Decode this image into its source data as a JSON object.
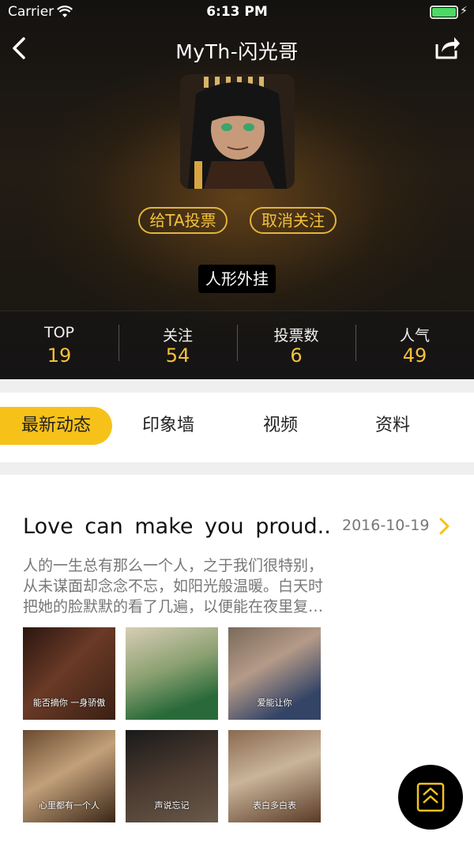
{
  "status_bar": {
    "carrier": "Carrier",
    "time": "6:13 PM"
  },
  "header": {
    "title": "MyTh-闪光哥",
    "vote_label": "给TA投票",
    "unfollow_label": "取消关注",
    "tag": "人形外挂"
  },
  "stats": [
    {
      "label": "TOP",
      "value": "19"
    },
    {
      "label": "关注",
      "value": "54"
    },
    {
      "label": "投票数",
      "value": "6"
    },
    {
      "label": "人气",
      "value": "49"
    }
  ],
  "tabs": [
    {
      "label": "最新动态",
      "active": true
    },
    {
      "label": "印象墙",
      "active": false
    },
    {
      "label": "视频",
      "active": false
    },
    {
      "label": "资料",
      "active": false
    }
  ],
  "post": {
    "title": "Love can make you proud...",
    "date": "2016-10-19",
    "body_lines": [
      "人的一生总有那么一个人，之于我们很特别，",
      "从未谋面却念念不忘，如阳光般温暖。白天时",
      "把她的脸默默的看了几遍，以便能在夜里复…"
    ],
    "photos": [
      {
        "caption": "能否摘你 一身骄傲"
      },
      {
        "caption": ""
      },
      {
        "caption": "爱能让你"
      },
      {
        "caption": "心里都有一个人"
      },
      {
        "caption": "声说忘记"
      },
      {
        "caption": "表白多白表"
      }
    ]
  },
  "colors": {
    "accent": "#f6c21a",
    "gold_text": "#f2c13b",
    "dark_bg": "#1c1812"
  },
  "icons": [
    "back-arrow-icon",
    "share-icon",
    "chevron-right-icon",
    "scroll-top-icon",
    "wifi-icon",
    "battery-icon"
  ]
}
